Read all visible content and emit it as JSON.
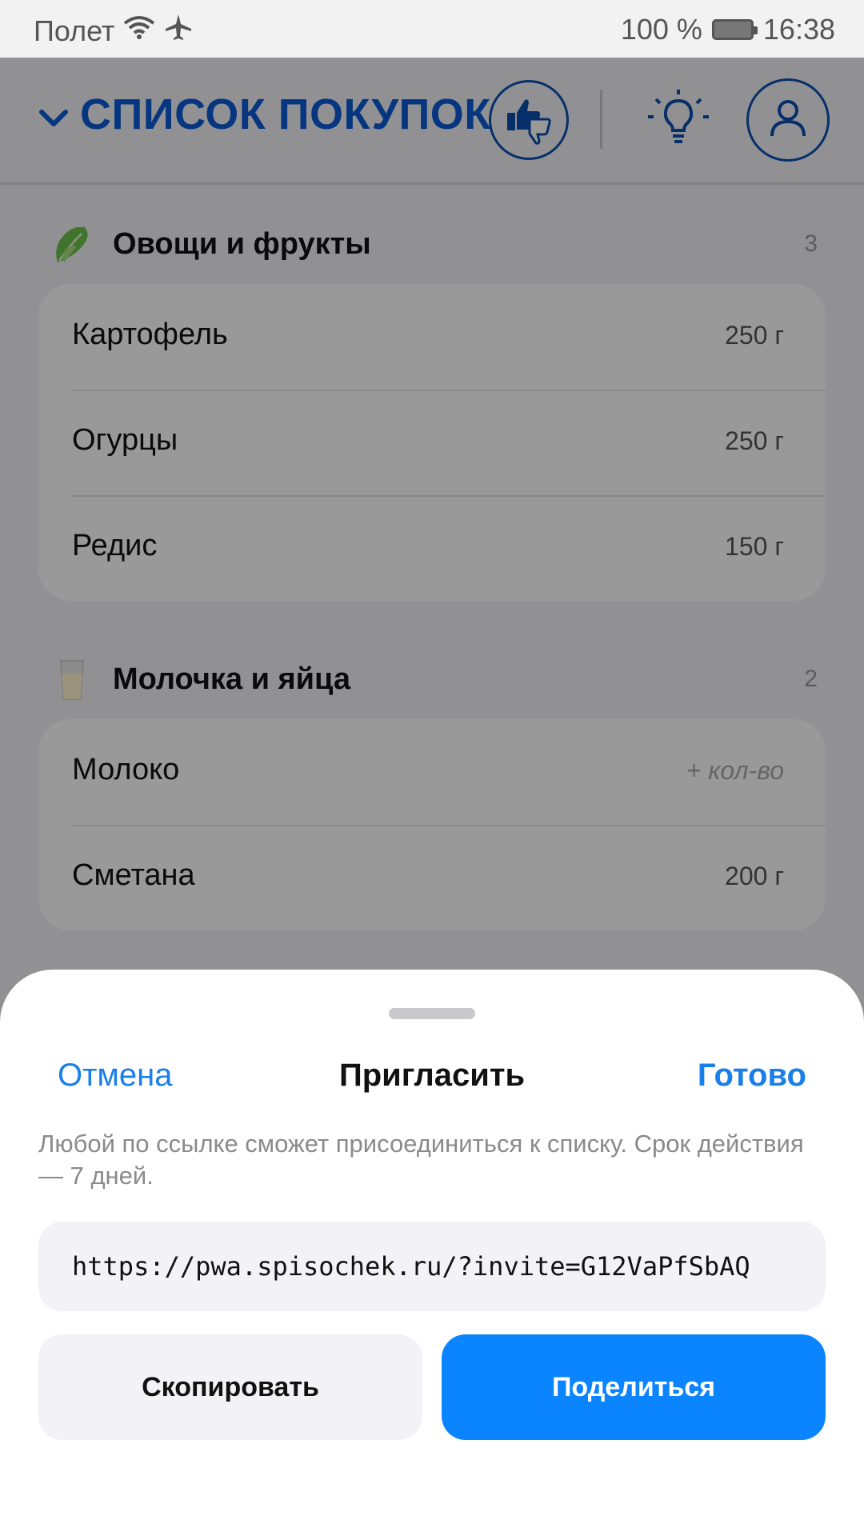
{
  "status_bar": {
    "carrier": "Полет",
    "battery": "100 %",
    "time": "16:38"
  },
  "header": {
    "list_title": "СПИСОК ПОКУПОК"
  },
  "sections": [
    {
      "name": "Овощи и фрукты",
      "count": "3",
      "icon": "lettuce-icon",
      "items": [
        {
          "name": "Картофель",
          "qty": "250 г"
        },
        {
          "name": "Огурцы",
          "qty": "250 г"
        },
        {
          "name": "Редис",
          "qty": "150 г"
        }
      ]
    },
    {
      "name": "Молочка и яйца",
      "count": "2",
      "icon": "milk-glass-icon",
      "items": [
        {
          "name": "Молоко",
          "qty": "+ кол-во"
        },
        {
          "name": "Сметана",
          "qty": "200 г"
        }
      ]
    }
  ],
  "sheet": {
    "cancel": "Отмена",
    "title": "Пригласить",
    "done": "Готово",
    "description": "Любой по ссылке сможет присоединиться к списку. Срок действия — 7 дней.",
    "link": "https://pwa.spisochek.ru/?invite=G12VaPfSbAQ",
    "copy_button": "Скопировать",
    "share_button": "Поделиться"
  },
  "colors": {
    "accent": "#0a84ff",
    "title_blue": "#0a5bd6",
    "link_blue": "#1a7fe8"
  }
}
